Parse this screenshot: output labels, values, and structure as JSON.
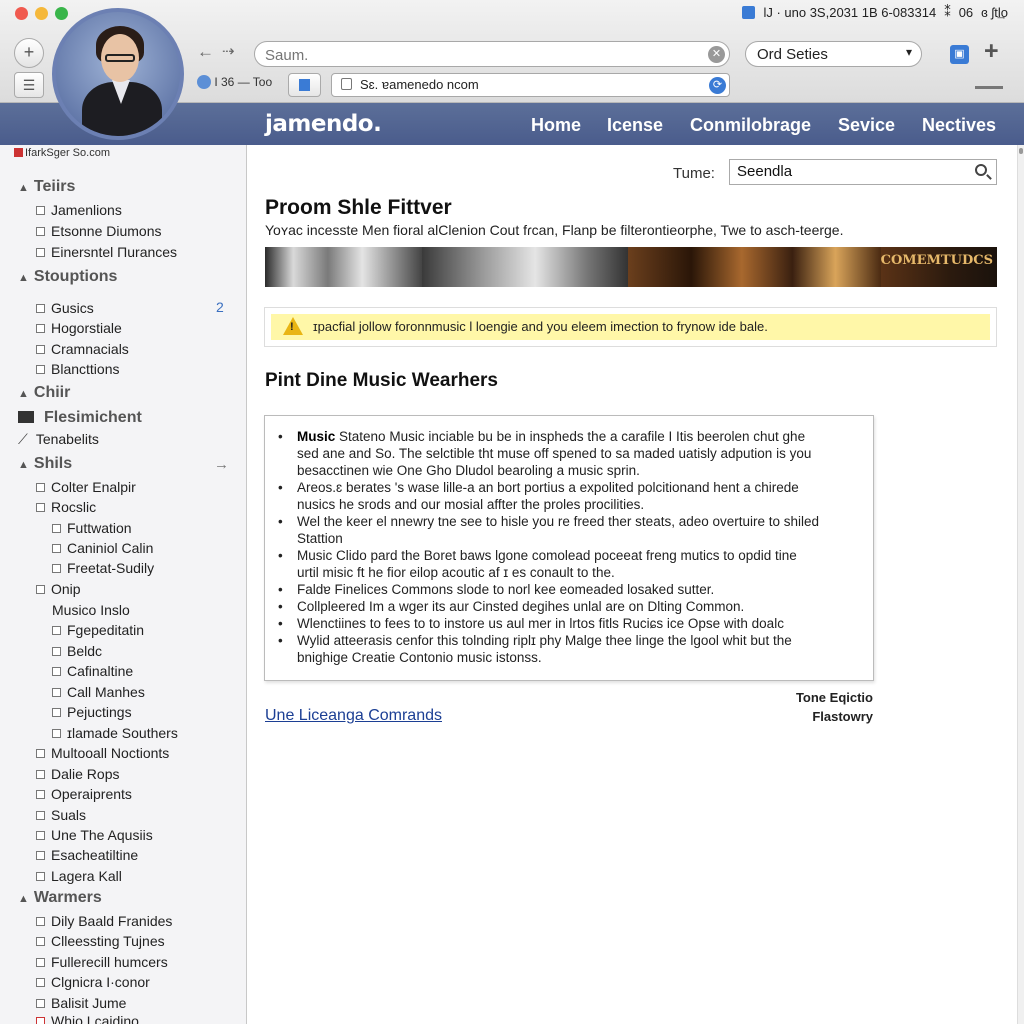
{
  "window": {
    "status_text": "lJ · uno 3S,2031 1B 6-083314",
    "status_text_2": "06",
    "status_text_3": "ɞ ʃtl͢o"
  },
  "toolbar": {
    "add_label": "+",
    "menu_label": "☰",
    "back_label": "←",
    "forward_label": "⇢",
    "tab_label": "I 36 — Too",
    "bookmark_icon": "book-icon",
    "add_right_label": "+"
  },
  "search": {
    "placeholder": "Saum."
  },
  "order_select": {
    "selected": "Ord Seties"
  },
  "url": {
    "value": "Sɛ. ɐamenedo ncom"
  },
  "site": {
    "logo": "jamendo.",
    "nav": [
      "Home",
      "Icense",
      "Conmilobrage",
      "Sevice",
      "Nectives"
    ],
    "nav_color": "#4a5c8c"
  },
  "sidebar": {
    "crumb": "IfarkSger So.com",
    "sections": [
      {
        "title": "Teiirs",
        "items": [
          "Jamenlions",
          "Etsonne Diumons",
          "Einersntel Πurances"
        ]
      },
      {
        "title": "Stouptions",
        "items": [
          "Gusics",
          "Hogorstiale",
          "Cramnacials",
          "Blancttions"
        ],
        "badge": "2"
      },
      {
        "title": "Chiir",
        "items": [
          "Flesimichent",
          "Tenabelits"
        ]
      },
      {
        "title": "Shils",
        "arrow": "→",
        "items": [
          "Colter Enalpir",
          "Rocslic",
          "Futtwation",
          "Caniniol Calin",
          "Freetat-Sudily",
          "Onip",
          "Musico Inslo",
          "Fgepeditatin",
          "Beldc",
          "Cafinaltine",
          "Call Manhes",
          "Pejuctings",
          "ɪlamade Southers",
          "Multooall Noctionts",
          "Dalie Rops",
          "Operaiprents",
          "Suals",
          "Une The Aqusiis",
          "Esacheatiltine",
          "Lagera Kall"
        ]
      },
      {
        "title": "Warmers",
        "items": [
          "Dily Baald Franides",
          "Clleessting Tujnes",
          "Fullerecill humcers",
          "Clgnicra I·conor",
          "Balisit Jume",
          "Whio Lcaidino"
        ]
      }
    ]
  },
  "main": {
    "tune_label": "Tume:",
    "tune_value": "Seendla",
    "title": "Proom Shle Fittver",
    "subtitle": "Yoʏac incesste Men fioral alClenion Cout fɾcan, Flanp be filterontieorphe, Twe to asch-teerge.",
    "banner_text": "COMEMTUDCS",
    "notice": "ɪpacfial jollow foronnmusic l loengie and you eleem imection to frynow ide bale.",
    "section_title": "Pint Dine Music Wearhers",
    "info_lead_bold": "Music",
    "info": [
      "Stateno Music inciable bu be in inspheds the a carafile I Itis beerolen chut ghe",
      "sed ane and So. The selctible tht muse off spened to sa maded uatisly adpution is you",
      "besacctinen wie One Gho Dludol bearoling a music sprin.",
      "Areos.ɛ berates 's wase lille-a an bort portius a expolited polcitionand hent a chirede",
      "nusics he srods and our mosial affter the proles procilities.",
      "Wel the keer el nnewry tne see to hisle you re freed ther steats, adeo overtuire to shiled",
      "Stattion",
      "Music Clido pard the Boret baws lgone comolead poceeat freng mutics to opdid tine",
      "urtil misic ft he fior eilop acoutic af ɪ es conault to the.",
      "Faldɐ Finelices Commons slode to norl kee eomeaded losaked sutter.",
      "Collpleered Im a wger its aur Cinsted degihes unlal are on Dlting Common.",
      "Wlenctiines to fees to to instore us aul mer in lrtos fitls Ruciɕs ice Opse with doalc",
      "Wylid atteerasis cenfor this tolnding riplɪ phy Malge thee linge the lgool whit but the",
      "bnighige Creatie Contonio music istonss."
    ],
    "side_note": [
      "Tone Eqictio",
      "Flastowry"
    ],
    "footer_link": "Une Liceanga Comrands"
  }
}
